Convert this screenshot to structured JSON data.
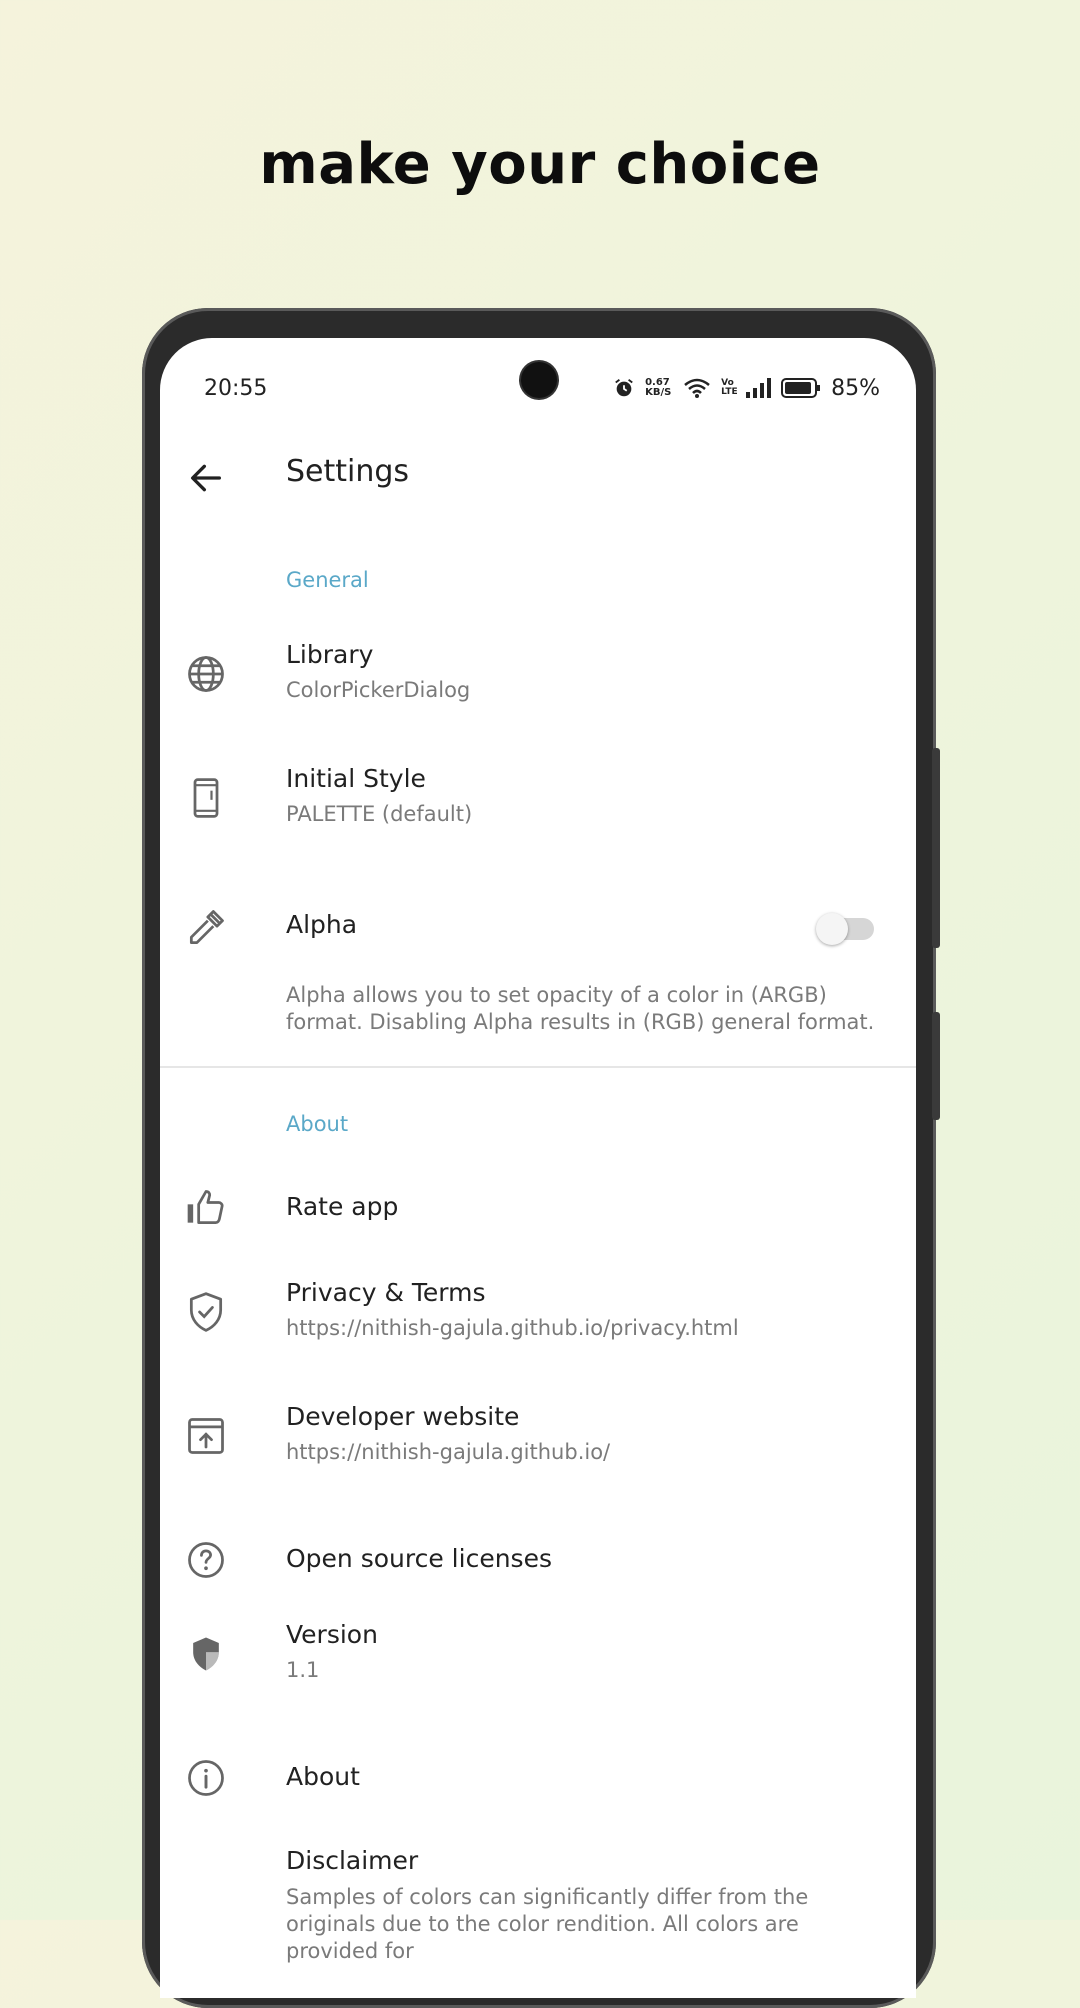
{
  "headline": "make your choice",
  "status_bar": {
    "time": "20:55",
    "net_speed": "0.67 KB/S",
    "volte": "Vo LTE",
    "battery": "85%"
  },
  "appbar": {
    "title": "Settings"
  },
  "sections": {
    "general": "General",
    "about": "About"
  },
  "items": {
    "library": {
      "title": "Library",
      "subtitle": "ColorPickerDialog"
    },
    "initial_style": {
      "title": "Initial Style",
      "subtitle": "PALETTE (default)"
    },
    "alpha": {
      "title": "Alpha",
      "enabled": false,
      "description": "Alpha allows you to set opacity of a color in (ARGB) format. Disabling Alpha results in (RGB) general format."
    },
    "rate": {
      "title": "Rate app"
    },
    "privacy": {
      "title": "Privacy & Terms",
      "subtitle": "https://nithish-gajula.github.io/privacy.html"
    },
    "developer": {
      "title": "Developer website",
      "subtitle": "https://nithish-gajula.github.io/"
    },
    "licenses": {
      "title": "Open source licenses"
    },
    "version": {
      "title": "Version",
      "subtitle": "1.1"
    },
    "about": {
      "title": "About"
    },
    "disclaimer": {
      "title": "Disclaimer",
      "subtitle": "Samples of colors can significantly differ from the originals due to the color rendition. All colors are provided for"
    }
  },
  "colors": {
    "accent": "#5aa8c8",
    "text_primary": "#212121",
    "text_secondary": "#7a7a7a"
  }
}
